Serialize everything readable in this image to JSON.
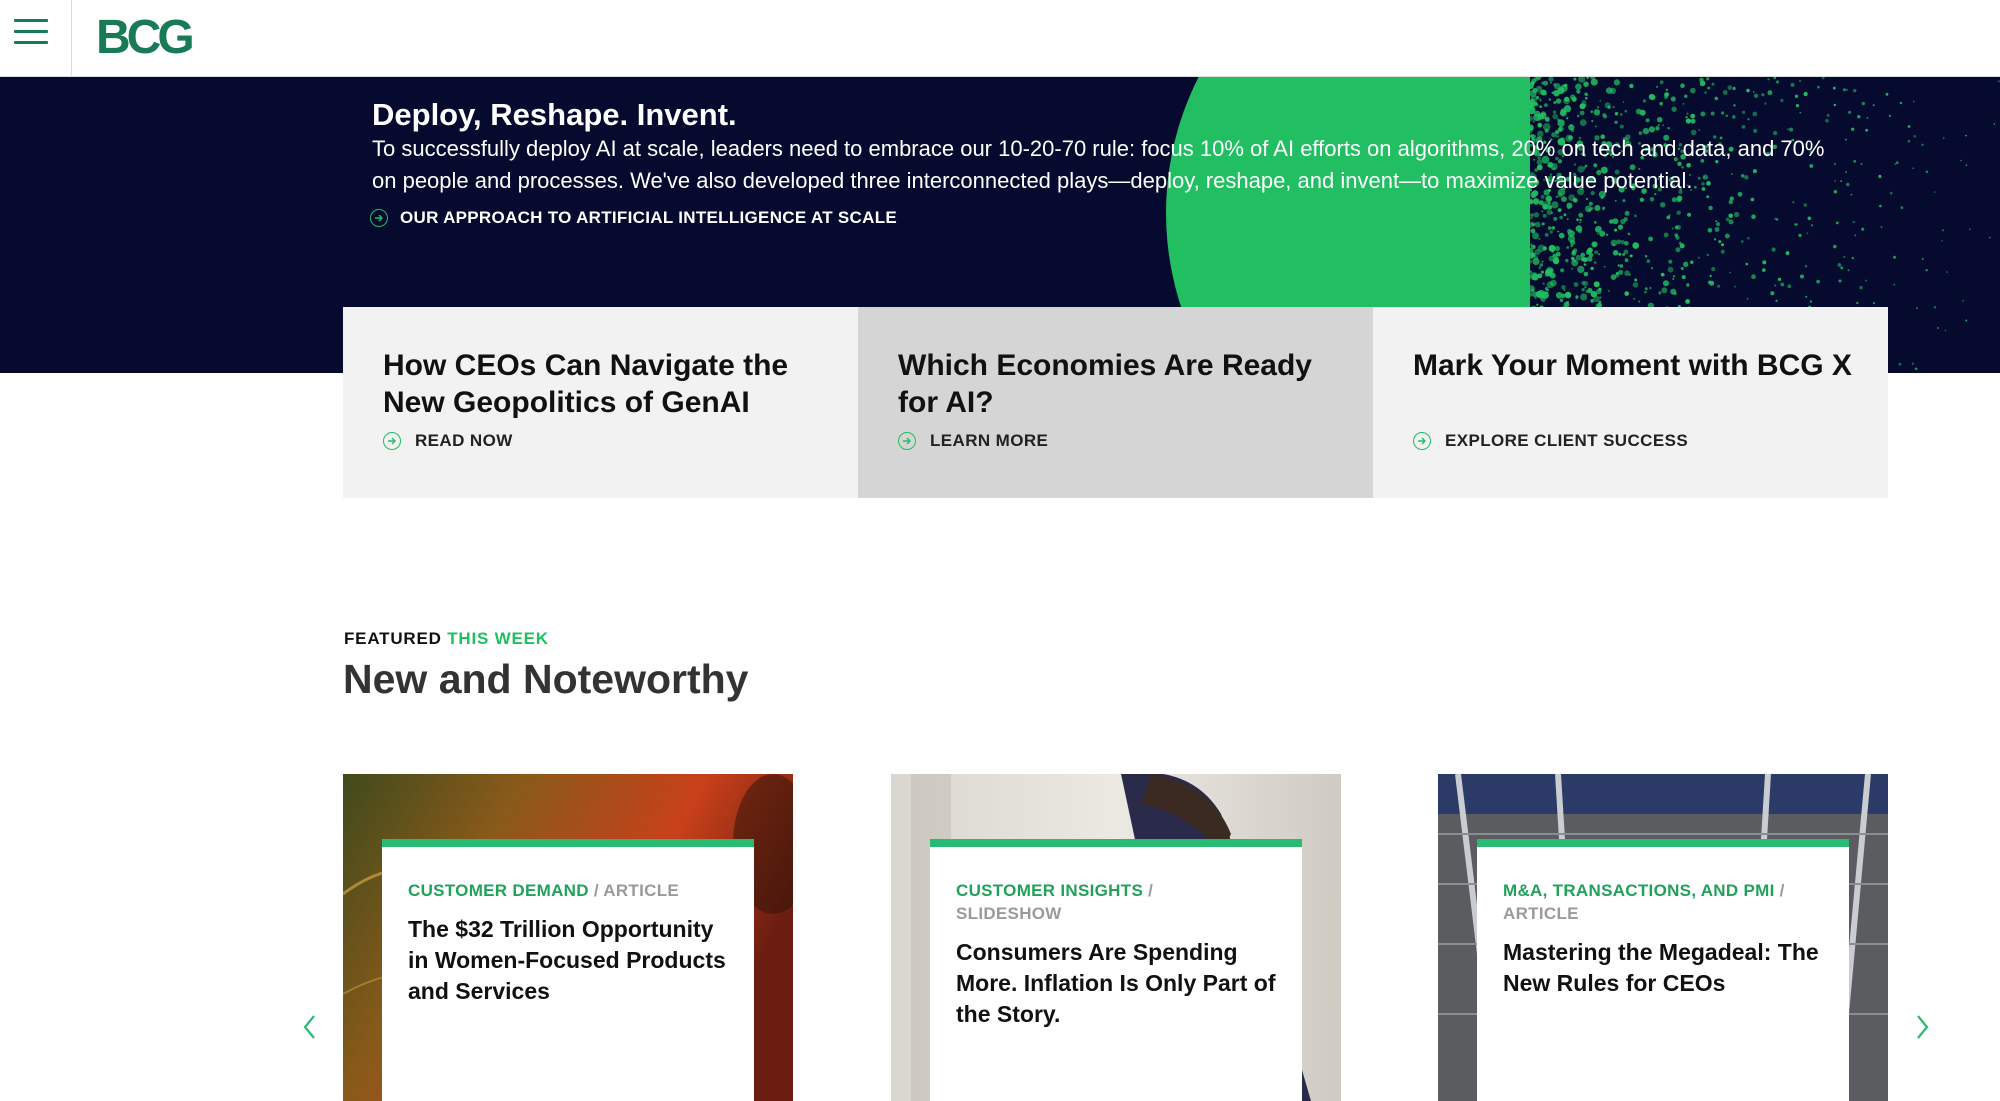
{
  "header": {
    "logo_text": "BCG",
    "menu_icon": "hamburger-menu-icon"
  },
  "hero": {
    "title": "Deploy, Reshape. Invent.",
    "body": "To successfully deploy AI at scale, leaders need to embrace our 10-20-70 rule: focus 10% of AI efforts on algorithms, 20% on tech and data, and 70% on people and processes. We've also developed three interconnected plays—deploy, reshape, and invent—to maximize value potential.",
    "link_label": "OUR APPROACH TO ARTIFICIAL INTELLIGENCE AT SCALE",
    "link_icon": "circle-arrow-right-icon"
  },
  "promos": [
    {
      "title": "How CEOs Can Navigate the New Geopolitics of GenAI",
      "cta": "READ NOW"
    },
    {
      "title": "Which Economies Are Ready for AI?",
      "cta": "LEARN MORE"
    },
    {
      "title": "Mark Your Moment with BCG X",
      "cta": "EXPLORE CLIENT SUCCESS"
    }
  ],
  "featured": {
    "kicker_prefix": "FEATURED",
    "kicker_highlight": "THIS WEEK",
    "title": "New and Noteworthy",
    "cards": [
      {
        "category": "CUSTOMER DEMAND",
        "separator": "/",
        "type": "ARTICLE",
        "title": "The $32 Trillion Opportunity in Women-Focused Products and Services"
      },
      {
        "category": "CUSTOMER INSIGHTS",
        "separator": "/",
        "type": "SLIDESHOW",
        "title": "Consumers Are Spending More. Inflation Is Only Part of the Story."
      },
      {
        "category": "M&A, TRANSACTIONS, AND PMI",
        "separator": "/",
        "type": "ARTICLE",
        "title": "Mastering the Megadeal: The New Rules for CEOs"
      }
    ],
    "prev_icon": "chevron-left-icon",
    "next_icon": "chevron-right-icon"
  },
  "colors": {
    "brand_green": "#197a56",
    "accent_green": "#21bf61",
    "hero_navy": "#050a2e",
    "promo_light": "#f2f2f2",
    "promo_mid": "#d5d5d5"
  }
}
